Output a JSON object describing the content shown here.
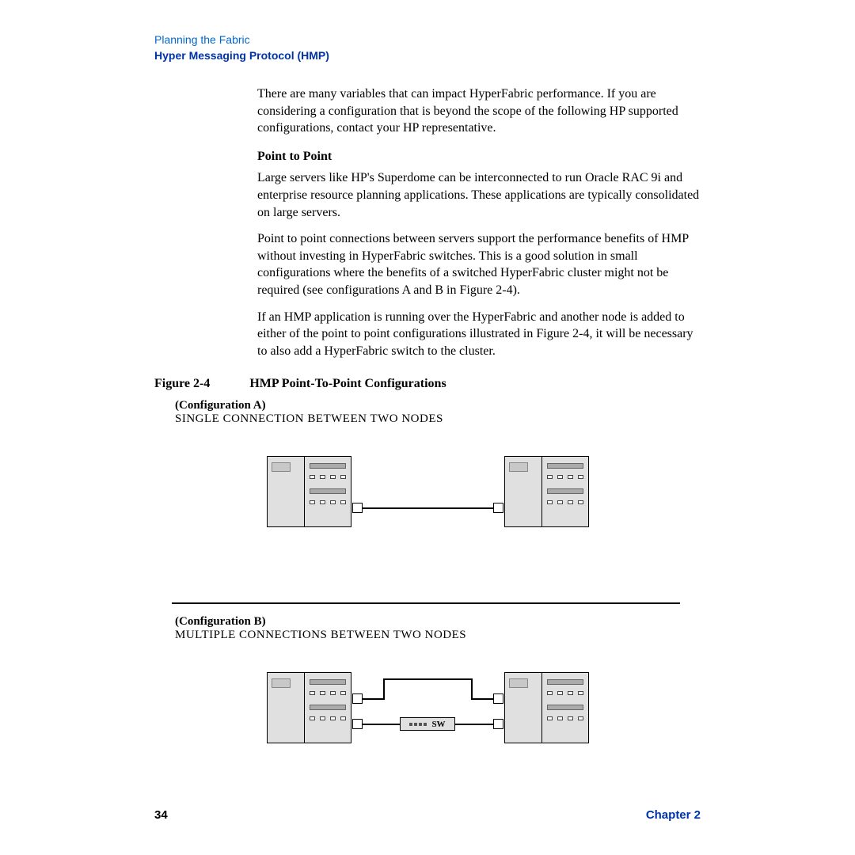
{
  "header": {
    "section": "Planning the Fabric",
    "subsection": "Hyper Messaging Protocol (HMP)"
  },
  "body": {
    "intro": "There are many variables that can impact HyperFabric performance. If you are considering a configuration that is beyond the scope of the following HP supported configurations, contact your HP representative.",
    "h1": "Point to Point",
    "p1": "Large servers like HP's Superdome can be interconnected to run Oracle RAC 9i and enterprise resource planning applications. These applications are typically consolidated on large servers.",
    "p2": "Point to point connections between servers support the performance benefits of HMP without investing in HyperFabric switches. This is a good solution in small configurations where the benefits of a switched HyperFabric cluster might not be required (see configurations A and B in Figure 2-4).",
    "p3": "If an HMP application is running over the HyperFabric and another node is added to either of the point to point configurations illustrated in Figure 2-4, it will be necessary to also add a HyperFabric switch to the cluster."
  },
  "figure": {
    "label": "Figure 2-4",
    "title": "HMP Point-To-Point Configurations",
    "configA": {
      "label": "(Configuration A)",
      "title": "SINGLE CONNECTION BETWEEN TWO NODES"
    },
    "configB": {
      "label": "(Configuration B)",
      "title": "MULTIPLE CONNECTIONS  BETWEEN TWO NODES",
      "switch": "SW"
    }
  },
  "footer": {
    "page": "34",
    "chapter": "Chapter 2"
  }
}
